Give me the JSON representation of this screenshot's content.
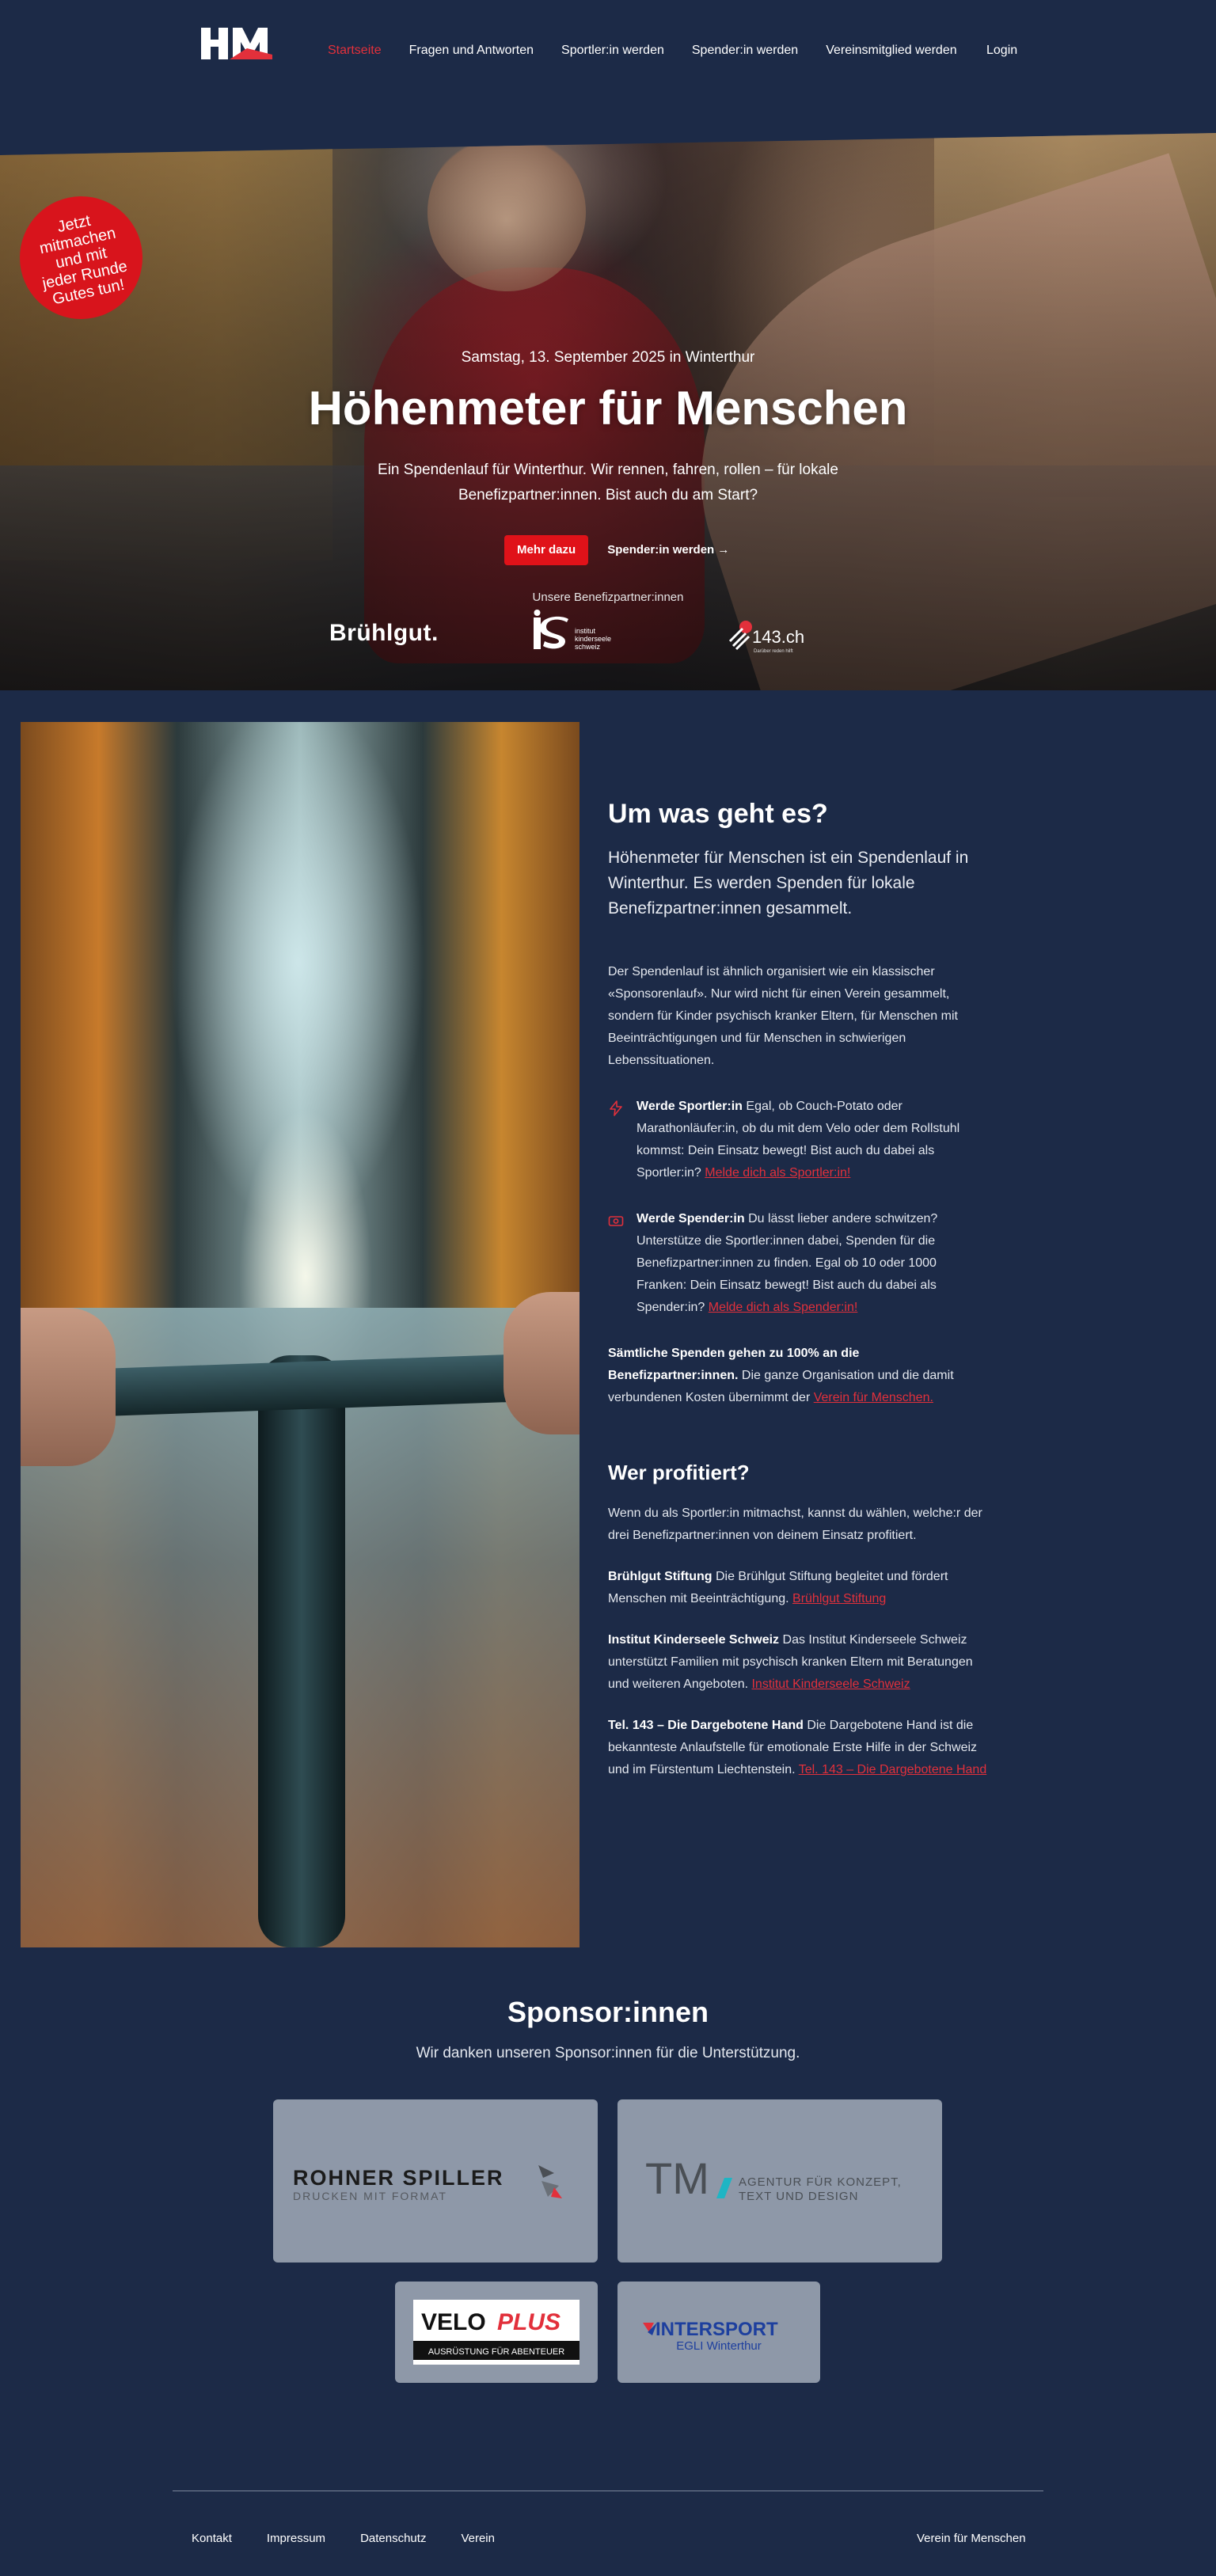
{
  "header": {
    "logo_text": "HfM",
    "nav": [
      {
        "label": "Startseite",
        "active": true
      },
      {
        "label": "Fragen und Antworten",
        "active": false
      },
      {
        "label": "Sportler:in werden",
        "active": false
      },
      {
        "label": "Spender:in werden",
        "active": false
      },
      {
        "label": "Vereinsmitglied werden",
        "active": false
      }
    ],
    "login": "Login"
  },
  "badge": "Jetzt mitmachen und mit jeder Runde Gutes tun!",
  "hero": {
    "date": "Samstag, 13. September 2025 in Winterthur",
    "title": "Höhenmeter für Menschen",
    "subtitle": "Ein Spendenlauf für Winterthur. Wir rennen, fahren, rollen – für lokale Benefizpartner:innen. Bist auch du am Start?",
    "primary_button": "Mehr dazu",
    "secondary_button": "Spender:in werden →",
    "partners_label": "Unsere Benefizpartner:innen",
    "partners": {
      "bruehlgut": "Brühlgut.",
      "is_short": "is",
      "is_lines": [
        "institut",
        "kinderseele",
        "schweiz"
      ],
      "tel143": "143.ch",
      "tel143_tag": "Darüber reden hilft"
    }
  },
  "about": {
    "title": "Um was geht es?",
    "lead": "Höhenmeter für Menschen ist ein Spendenlauf in Winterthur. Es werden Spenden für lokale Benefizpartner:innen gesammelt.",
    "intro": "Der Spendenlauf ist ähnlich organisiert wie ein klassischer «Sponsorenlauf». Nur wird nicht für einen Verein gesammelt, sondern für Kinder psychisch kranker Eltern, für Menschen mit Beeinträchtigungen und für Menschen in schwierigen Lebenssituationen.",
    "feature_sport": {
      "bold": "Werde Sportler:in",
      "text": " Egal, ob Couch-Potato oder Marathonläufer:in, ob du mit dem Velo oder dem Rollstuhl kommst: Dein Einsatz bewegt! Bist auch du dabei als Sportler:in? ",
      "link": "Melde dich als Sportler:in!"
    },
    "feature_donor": {
      "bold": "Werde Spender:in",
      "text": " Du lässt lieber andere schwitzen? Unterstütze die Sportler:innen dabei, Spenden für die Benefizpartner:innen zu finden. Egal ob 10 oder 1000 Franken: Dein Einsatz bewegt! Bist auch du dabei als Spender:in? ",
      "link": "Melde dich als Spender:in!"
    },
    "note": {
      "bold": "Sämtliche Spenden gehen zu 100% an die Benefizpartner:innen.",
      "text": " Die ganze Organisation und die damit verbundenen Kosten übernimmt der ",
      "link": "Verein für Menschen."
    },
    "benefit_title": "Wer profitiert?",
    "benefit_intro": "Wenn du als Sportler:in mitmachst, kannst du wählen, welche:r der drei Benefizpartner:innen von deinem Einsatz profitiert.",
    "partners": [
      {
        "bold": "Brühlgut Stiftung",
        "text": " Die Brühlgut Stiftung begleitet und fördert Menschen mit Beeinträchtigung. ",
        "link": "Brühlgut Stiftung"
      },
      {
        "bold": "Institut Kinderseele Schweiz",
        "text": " Das Institut Kinderseele Schweiz unterstützt Familien mit psychisch kranken Eltern mit Beratungen und weiteren Angeboten. ",
        "link": "Institut Kinderseele Schweiz"
      },
      {
        "bold": "Tel. 143 – Die Dargebotene Hand",
        "text": " Die Dargebotene Hand ist die bekannteste Anlaufstelle für emotionale Erste Hilfe in der Schweiz und im Fürstentum Liechtenstein. ",
        "link": "Tel. 143 – Die Dargebotene Hand"
      }
    ]
  },
  "sponsors": {
    "title": "Sponsor:innen",
    "subtitle": "Wir danken unseren Sponsor:innen für die Unterstützung.",
    "rohner": {
      "name": "ROHNER SPILLER",
      "tag": "DRUCKEN MIT FORMAT"
    },
    "tm": {
      "name": "TM",
      "line1": "AGENTUR FÜR KONZEPT,",
      "line2": "TEXT UND DESIGN"
    },
    "veloplus": {
      "velo": "VELO",
      "plus": "PLUS",
      "tag": "AUSRÜSTUNG FÜR ABENTEUER"
    },
    "intersport": {
      "name": "INTERSPORT",
      "sub": "EGLI Winterthur"
    }
  },
  "footer": {
    "links": [
      "Kontakt",
      "Impressum",
      "Datenschutz",
      "Verein"
    ],
    "right": "Verein für Menschen"
  },
  "colors": {
    "background": "#1c2a47",
    "accent_red": "#e2303b",
    "button_red": "#e01219",
    "card": "#8e98a8"
  }
}
